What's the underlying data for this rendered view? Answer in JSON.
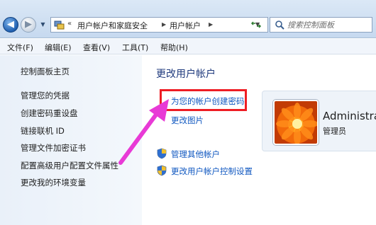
{
  "breadcrumb": [
    "用户帐户和家庭安全",
    "用户帐户"
  ],
  "breadcrumb_prefix": "«",
  "search": {
    "placeholder": "搜索控制面板"
  },
  "menu": [
    "文件(F)",
    "编辑(E)",
    "查看(V)",
    "工具(T)",
    "帮助(H)"
  ],
  "sidebar": {
    "home": "控制面板主页",
    "items": [
      "管理您的凭据",
      "创建密码重设盘",
      "链接联机 ID",
      "管理文件加密证书",
      "配置高级用户配置文件属性",
      "更改我的环境变量"
    ]
  },
  "main": {
    "title": "更改用户帐户",
    "actions": [
      "为您的帐户创建密码",
      "更改图片"
    ],
    "shield_links": [
      "管理其他帐户",
      "更改用户帐户控制设置"
    ]
  },
  "user": {
    "name": "Administra",
    "role": "管理员"
  },
  "colors": {
    "highlight": "#ee1d24",
    "arrow": "#e83ad6",
    "link": "#0f57c0",
    "title": "#1f3a7d"
  },
  "icons": {
    "back": "back-arrow-icon",
    "forward": "forward-arrow-icon",
    "address": "control-panel-icon",
    "refresh": "refresh-icon",
    "search": "search-icon",
    "shield": "uac-shield-icon"
  }
}
